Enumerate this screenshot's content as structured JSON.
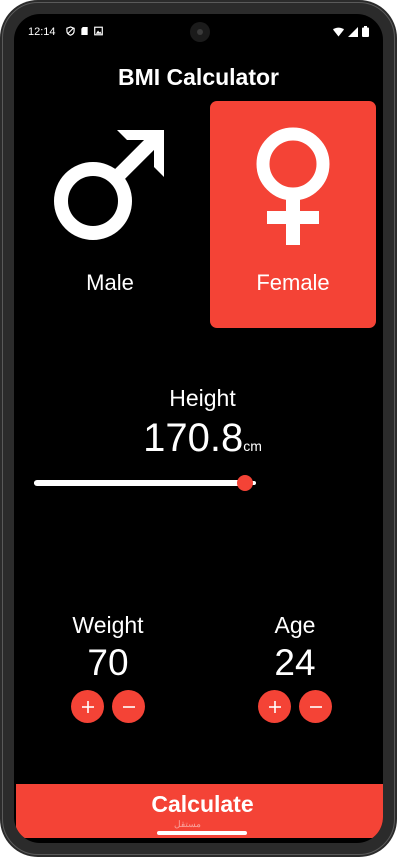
{
  "status_bar": {
    "time": "12:14",
    "left_icons": [
      "shield-icon",
      "sd-card-icon",
      "photo-icon"
    ],
    "right_icons": [
      "wifi-icon",
      "signal-icon",
      "battery-icon"
    ]
  },
  "app": {
    "title": "BMI Calculator"
  },
  "gender": {
    "male": {
      "label": "Male",
      "icon": "male-symbol-icon"
    },
    "female": {
      "label": "Female",
      "icon": "female-symbol-icon"
    },
    "selected": "female"
  },
  "height": {
    "label": "Height",
    "value": "170.8",
    "unit": "cm",
    "slider_fraction": 0.95
  },
  "weight": {
    "label": "Weight",
    "value": "70",
    "plus": "+",
    "minus": "−"
  },
  "age": {
    "label": "Age",
    "value": "24",
    "plus": "+",
    "minus": "−"
  },
  "calculate": {
    "label": "Calculate"
  },
  "watermark": "مستقل",
  "colors": {
    "accent": "#f44336",
    "background": "#000000",
    "text": "#ffffff"
  }
}
